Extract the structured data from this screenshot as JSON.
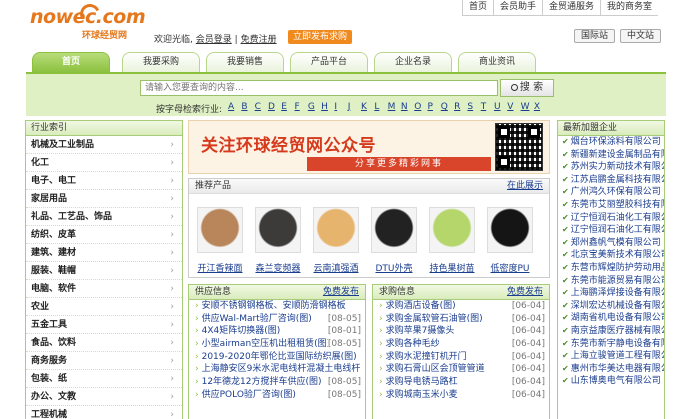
{
  "logo": {
    "word": "nowec.com",
    "sub": "环球经贸网"
  },
  "top_links": [
    "首页",
    "会员助手",
    "金贸通服务",
    "我的商务室"
  ],
  "welcome": {
    "text": "欢迎光临,",
    "login": "会员登录",
    "sep": "|",
    "register": "免费注册"
  },
  "publish_button": "立即发布求购",
  "site_buttons": [
    "国际站",
    "中文站"
  ],
  "nav_tabs": [
    "首页",
    "我要采购",
    "我要销售",
    "产品平台",
    "企业名录",
    "商业资讯"
  ],
  "search": {
    "placeholder": "请输入您要查询的内容...",
    "button": "搜 索"
  },
  "alpha": {
    "label": "按字母检索行业:",
    "letters": [
      "A",
      "B",
      "C",
      "D",
      "E",
      "F",
      "G",
      "H",
      "I",
      "J",
      "K",
      "L",
      "M",
      "N",
      "O",
      "P",
      "Q",
      "R",
      "S",
      "T",
      "U",
      "V",
      "W",
      "X"
    ]
  },
  "left": {
    "title": "行业索引",
    "arrow": "›",
    "items": [
      "机械及工业制品",
      "化工",
      "电子、电工",
      "家居用品",
      "礼品、工艺品、饰品",
      "纺织、皮革",
      "建筑、建材",
      "服装、鞋帽",
      "电脑、软件",
      "农业",
      "五金工具",
      "食品、饮料",
      "商务服务",
      "包装、纸",
      "办公、文教",
      "工程机械"
    ]
  },
  "banner": {
    "t1": "关注环球经贸网公众号",
    "t2": "分享更多精彩网事"
  },
  "products": {
    "title": "推荐产品",
    "more": "在此展示",
    "items": [
      {
        "cap": "开江香辣面",
        "color": "#b8865a"
      },
      {
        "cap": "森兰变频器",
        "color": "#3d3a3a"
      },
      {
        "cap": "云南滇强酒",
        "color": "#e7b46d"
      },
      {
        "cap": "DTU外壳",
        "color": "#222222"
      },
      {
        "cap": "持色果树苗",
        "color": "#b4d66a"
      },
      {
        "cap": "低密度PU",
        "color": "#151515"
      }
    ]
  },
  "supply": {
    "title": "供应信息",
    "more": "免费发布",
    "rows": [
      {
        "t": "安顺不锈钢钢格板、安顺防滑钢格板",
        "d": ""
      },
      {
        "t": "供应Wal-Mart验厂咨询(图)",
        "d": "[08-05]"
      },
      {
        "t": "4X4矩阵切换器(图)",
        "d": "[08-01]"
      },
      {
        "t": "小型airman空压机出租租赁(图)",
        "d": "[08-05]"
      },
      {
        "t": "2019-2020年鄂伦比亚国际纺织展(图)",
        "d": ""
      },
      {
        "t": "上海静安区9米水泥电线杆混凝土电线杆",
        "d": ""
      },
      {
        "t": "12年德龙12方搅拌车供应(图)",
        "d": "[08-05]"
      },
      {
        "t": "供应POLO验厂咨询(图)",
        "d": "[08-05]"
      }
    ]
  },
  "purchase": {
    "title": "求购信息",
    "more": "免费发布",
    "rows": [
      {
        "t": "求购酒店设备(图)",
        "d": "[06-04]"
      },
      {
        "t": "求购金属软管石油管(图)",
        "d": "[06-04]"
      },
      {
        "t": "求购苹果7摄像头",
        "d": "[06-04]"
      },
      {
        "t": "求购各种毛纱",
        "d": "[06-04]"
      },
      {
        "t": "求购水泥撞钉机开门",
        "d": "[06-04]"
      },
      {
        "t": "求购石膏山区会顶管管道",
        "d": "[06-04]"
      },
      {
        "t": "求购导电锈马路杠",
        "d": "[06-04]"
      },
      {
        "t": "求购城南玉米小麦",
        "d": "[06-04]"
      }
    ]
  },
  "right": {
    "title": "最新加盟企业",
    "check": "✔",
    "items": [
      "烟台环保涂料有限公司",
      "新疆新建设金属制品有限",
      "苏州实力新动技术有限公",
      "江苏启鹏金属科技有限公",
      "广州鸿久环保有限公司",
      "东莞市艾丽塑胶科技有限",
      "辽宁恒润石油化工有限公",
      "辽宁恒润石油化工有限公",
      "郑州鑫帆气模有限公司",
      "北京宝美新技术有限公司",
      "东营市辉煌防护劳动用品",
      "东莞市能源贸易有限公司",
      "上海鹏泽焊接设备有限公",
      "深圳宏达机械设备有限公",
      "湖南省机电设备有限公司",
      "南京益康医疗器械有限公",
      "东莞市新宇静电设备有限",
      "上海立骏管道工程有限公",
      "惠州市华美达电器有限公",
      "山东博奥电气有限公司"
    ]
  }
}
